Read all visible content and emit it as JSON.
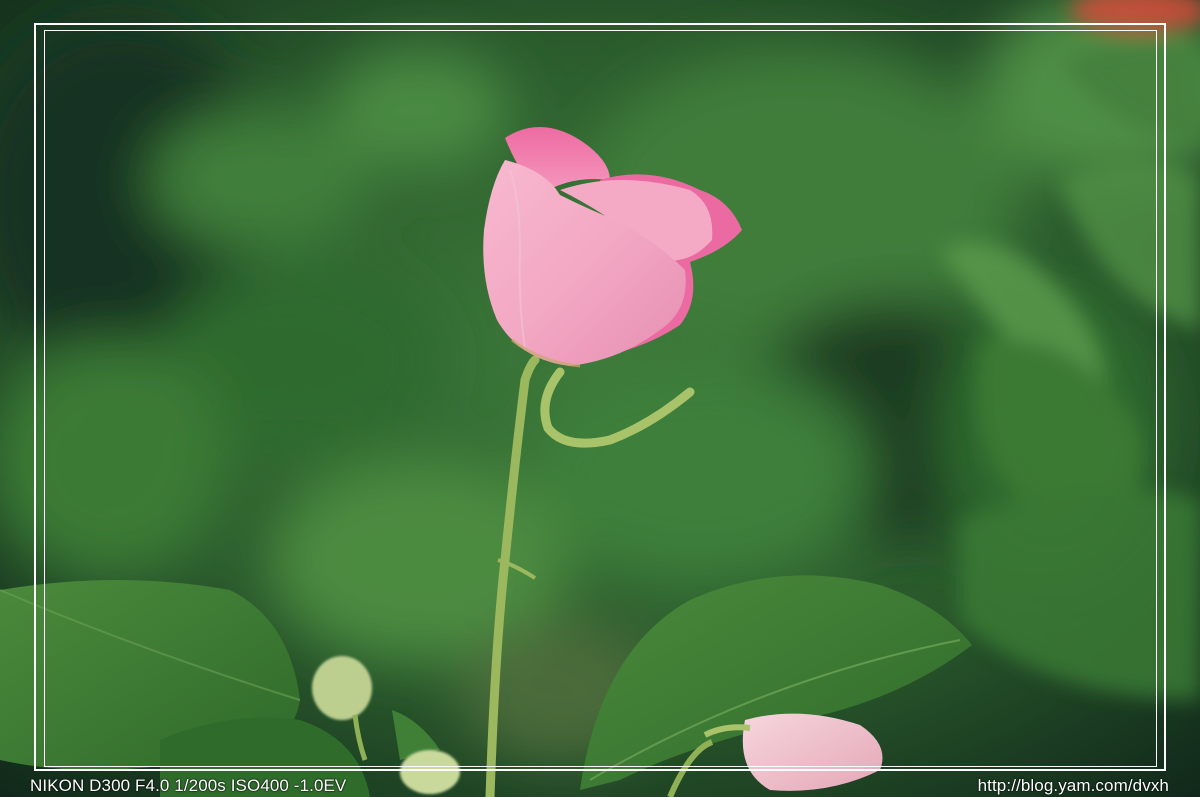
{
  "photo": {
    "subject": "pink flower bud on a green stem with leaves",
    "colors": {
      "background_dark": "#1f3a22",
      "background_mid": "#3f7a3c",
      "leaf": "#3e7e34",
      "petal_light": "#f5c2d3",
      "petal_dark": "#ec6aa2",
      "stem": "#8fb055",
      "frame": "#ffffff"
    }
  },
  "caption": {
    "exif": "NIKON D300 F4.0 1/200s ISO400 -1.0EV",
    "url": "http://blog.yam.com/dvxh"
  }
}
